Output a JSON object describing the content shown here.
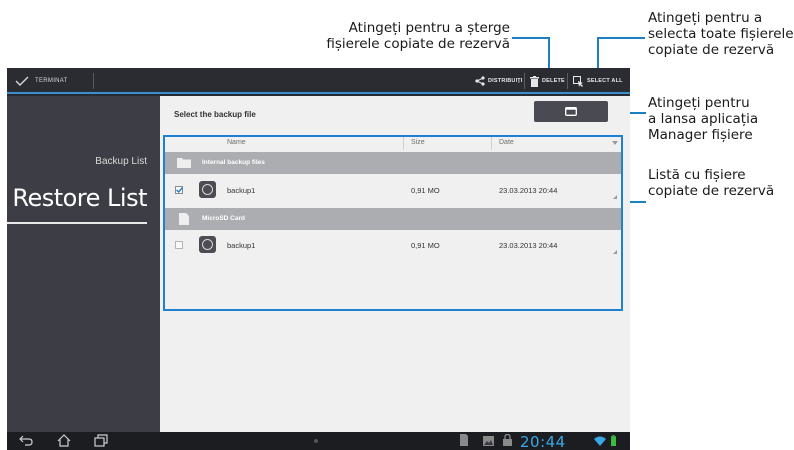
{
  "callouts": {
    "delete": [
      "Atingeți pentru a șterge",
      "fișierele copiate de rezervă"
    ],
    "select_all": [
      "Atingeți pentru a",
      "selecta toate fișierele",
      "copiate de rezervă"
    ],
    "file_manager": [
      "Atingeți pentru",
      "a lansa aplicația",
      "Manager fișiere"
    ],
    "backup_list": [
      "Listă cu fișiere",
      "copiate de rezervă"
    ]
  },
  "action_bar": {
    "done_label": "TERMINAT",
    "share_label": "DISTRIBUIȚI",
    "delete_label": "DELETE",
    "select_all_label": "SELECT ALL"
  },
  "sidebar": {
    "items": [
      {
        "label": "Backup List",
        "selected": false
      },
      {
        "label": "Restore List",
        "selected": true
      }
    ]
  },
  "content": {
    "title": "Select the backup file",
    "columns": [
      "Name",
      "Size",
      "Date"
    ],
    "groups": [
      {
        "label": "Internal backup files",
        "icon": "folder-icon",
        "rows": [
          {
            "name": "backup1",
            "size": "0,91 MO",
            "date": "23.03.2013 20:44",
            "checked": true
          }
        ]
      },
      {
        "label": "MicroSD Card",
        "icon": "sdcard-icon",
        "rows": [
          {
            "name": "backup1",
            "size": "0,91 MO",
            "date": "23.03.2013 20:44",
            "checked": false
          }
        ]
      }
    ]
  },
  "status_bar": {
    "time": "20:44"
  },
  "colors": {
    "accent": "#1f7fd0",
    "clock": "#3aa7e6",
    "battery": "#3dbb3d"
  }
}
